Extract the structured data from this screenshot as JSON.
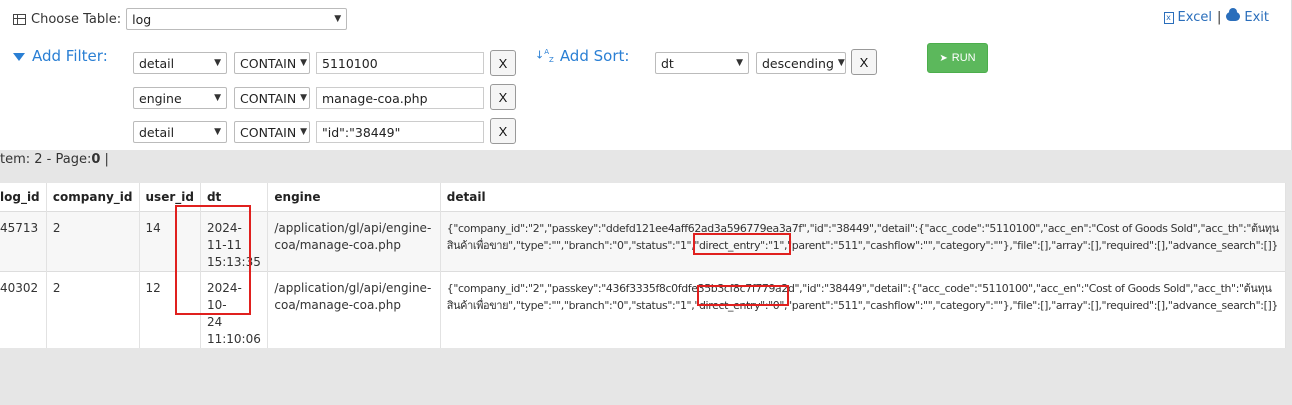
{
  "toolbar": {
    "choose_label": "Choose Table:",
    "table_value": "log",
    "excel_label": "Excel",
    "separator": "|",
    "exit_label": "Exit"
  },
  "filters": {
    "label": "Add Filter:",
    "rows": [
      {
        "field": "detail",
        "op": "CONTAIN",
        "value": "5110100",
        "remove": "X"
      },
      {
        "field": "engine",
        "op": "CONTAIN",
        "value": "manage-coa.php",
        "remove": "X"
      },
      {
        "field": "detail",
        "op": "CONTAIN",
        "value": "\"id\":\"38449\"",
        "remove": "X"
      }
    ]
  },
  "sort": {
    "label": "Add Sort:",
    "field": "dt",
    "direction": "descending",
    "remove": "X"
  },
  "run_label": "RUN",
  "status": {
    "prefix": "tem: 2 - Page:",
    "page": "0",
    "suffix": " |"
  },
  "table": {
    "columns": [
      "log_id",
      "company_id",
      "user_id",
      "dt",
      "engine",
      "detail"
    ],
    "rows": [
      {
        "log_id": "45713",
        "company_id": "2",
        "user_id": "14",
        "dt1": "2024-11-11",
        "dt2": "15:13:35",
        "eng1": "/application/gl/api/engine-",
        "eng2": "coa/manage-coa.php",
        "det1": "{\"company_id\":\"2\",\"passkey\":\"ddefd121ee4aff62ad3a596779ea3a7f\",\"id\":\"38449\",\"detail\":{\"acc_code\":\"5110100\",\"acc_en\":\"Cost of Goods Sold\",\"acc_th\":\"ต้นทุน",
        "det2": "สินค้าเพื่อขาย\",\"type\":\"\",\"branch\":\"0\",\"status\":\"1\",\"direct_entry\":\"1\",\"parent\":\"511\",\"cashflow\":\"\",\"category\":\"\"},\"file\":[],\"array\":[],\"required\":[],\"advance_search\":[]}"
      },
      {
        "log_id": "40302",
        "company_id": "2",
        "user_id": "12",
        "dt1": "2024-10-",
        "dt2": "24 11:10:06",
        "eng1": "/application/gl/api/engine-",
        "eng2": "coa/manage-coa.php",
        "det1": "{\"company_id\":\"2\",\"passkey\":\"436f3335f8c0fdfe35b3cf8c7f779a2d\",\"id\":\"38449\",\"detail\":{\"acc_code\":\"5110100\",\"acc_en\":\"Cost of Goods Sold\",\"acc_th\":\"ต้นทุน",
        "det2": "สินค้าเพื่อขาย\",\"type\":\"\",\"branch\":\"0\",\"status\":\"1\",\"direct_entry\":\"0\",\"parent\":\"511\",\"cashflow\":\"\",\"category\":\"\"},\"file\":[],\"array\":[],\"required\":[],\"advance_search\":[]}"
      }
    ]
  },
  "colors": {
    "link": "#2a6ebb",
    "accent": "#2a7fd4",
    "run": "#5cb85c",
    "highlight": "#e0201e"
  }
}
